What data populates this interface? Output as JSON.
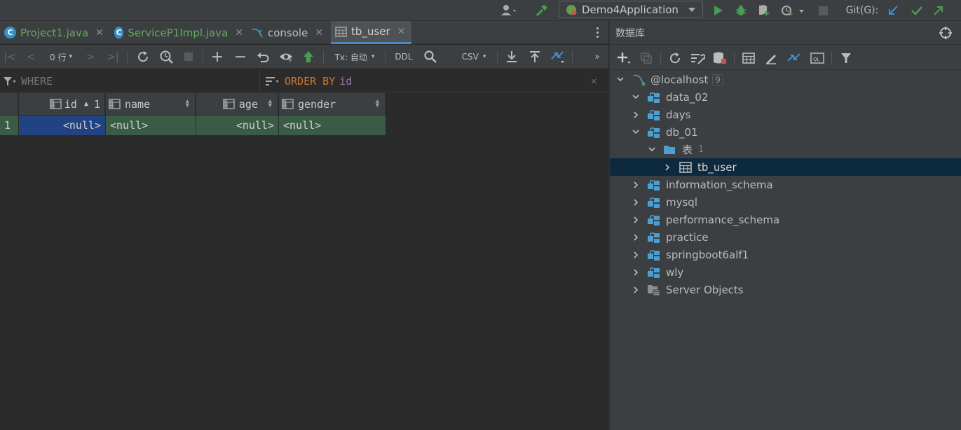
{
  "toolbar": {
    "run_config": "Demo4Application",
    "git_label": "Git(G):"
  },
  "editor_tabs": [
    {
      "label": "Project1.java",
      "icon": "java-class-icon",
      "color": "#62a85a"
    },
    {
      "label": "ServiceP1Impl.java",
      "icon": "java-class-icon",
      "color": "#62a85a"
    },
    {
      "label": "console",
      "icon": "mysql-icon",
      "color": "#bbbbbb"
    },
    {
      "label": "tb_user",
      "icon": "table-icon",
      "color": "#bbbbbb"
    }
  ],
  "grid_toolbar": {
    "rows_label": "0 行",
    "tx_label": "Tx: 自动",
    "ddl_label": "DDL",
    "csv_label": "CSV"
  },
  "filter": {
    "where_label": "WHERE",
    "order_by_keyword": "ORDER BY",
    "order_by_value": "id"
  },
  "result_table": {
    "columns": [
      {
        "name": "id",
        "sort_order": "1"
      },
      {
        "name": "name"
      },
      {
        "name": "age"
      },
      {
        "name": "gender"
      }
    ],
    "rows": [
      {
        "row_number": "1",
        "cells": [
          "<null>",
          "<null>",
          "<null>",
          "<null>"
        ]
      }
    ]
  },
  "database_panel": {
    "title": "数据库",
    "connection": {
      "label": "@localhost",
      "count": "9"
    },
    "tree": [
      {
        "label": "data_02",
        "expanded": true
      },
      {
        "label": "days",
        "expanded": false
      },
      {
        "label": "db_01",
        "expanded": true
      },
      {
        "label": "表",
        "count": "1",
        "expanded": true
      },
      {
        "label": "tb_user",
        "expanded": false,
        "selected": true
      },
      {
        "label": "information_schema",
        "expanded": false
      },
      {
        "label": "mysql",
        "expanded": false
      },
      {
        "label": "performance_schema",
        "expanded": false
      },
      {
        "label": "practice",
        "expanded": false
      },
      {
        "label": "springboot6alf1",
        "expanded": false
      },
      {
        "label": "wly",
        "expanded": false
      },
      {
        "label": "Server Objects",
        "expanded": false
      }
    ]
  },
  "colors": {
    "accent_blue": "#4a88c7",
    "run_green": "#499c54",
    "sql_keyword": "#cc7832",
    "sql_identifier": "#9876aa",
    "selected_cell": "#214283",
    "row_cell": "#3a5c46"
  }
}
